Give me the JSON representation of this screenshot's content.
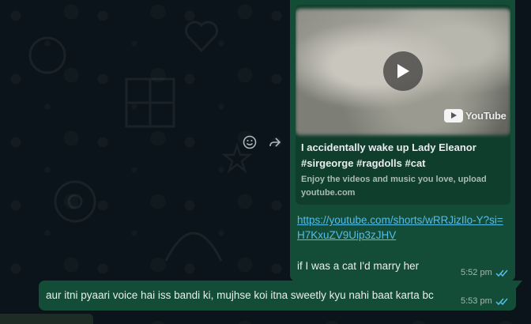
{
  "colors": {
    "chat_background": "#0b141a",
    "outgoing_bubble": "#144d37",
    "link": "#53bdeb",
    "read_ticks": "#53bdeb"
  },
  "hover_actions": [
    {
      "icon": "emoji-icon"
    },
    {
      "icon": "forward-icon"
    }
  ],
  "messages": [
    {
      "preview": {
        "title": "I accidentally wake up Lady Eleanor #sirgeorge #ragdolls #cat",
        "description": "Enjoy the videos and music you love, upload",
        "domain": "youtube.com",
        "badge": "YouTube"
      },
      "link": "https://youtube.com/shorts/wRRJizIlo-Y?si=H7KxuZV9Uip3zJHV",
      "text": "if I was a cat I'd marry her",
      "time": "5:52 pm",
      "status": "read"
    },
    {
      "text": "aur itni pyaari voice hai iss bandi ki, mujhse koi itna sweetly kyu nahi baat karta bc",
      "time": "5:53 pm",
      "status": "read"
    }
  ]
}
